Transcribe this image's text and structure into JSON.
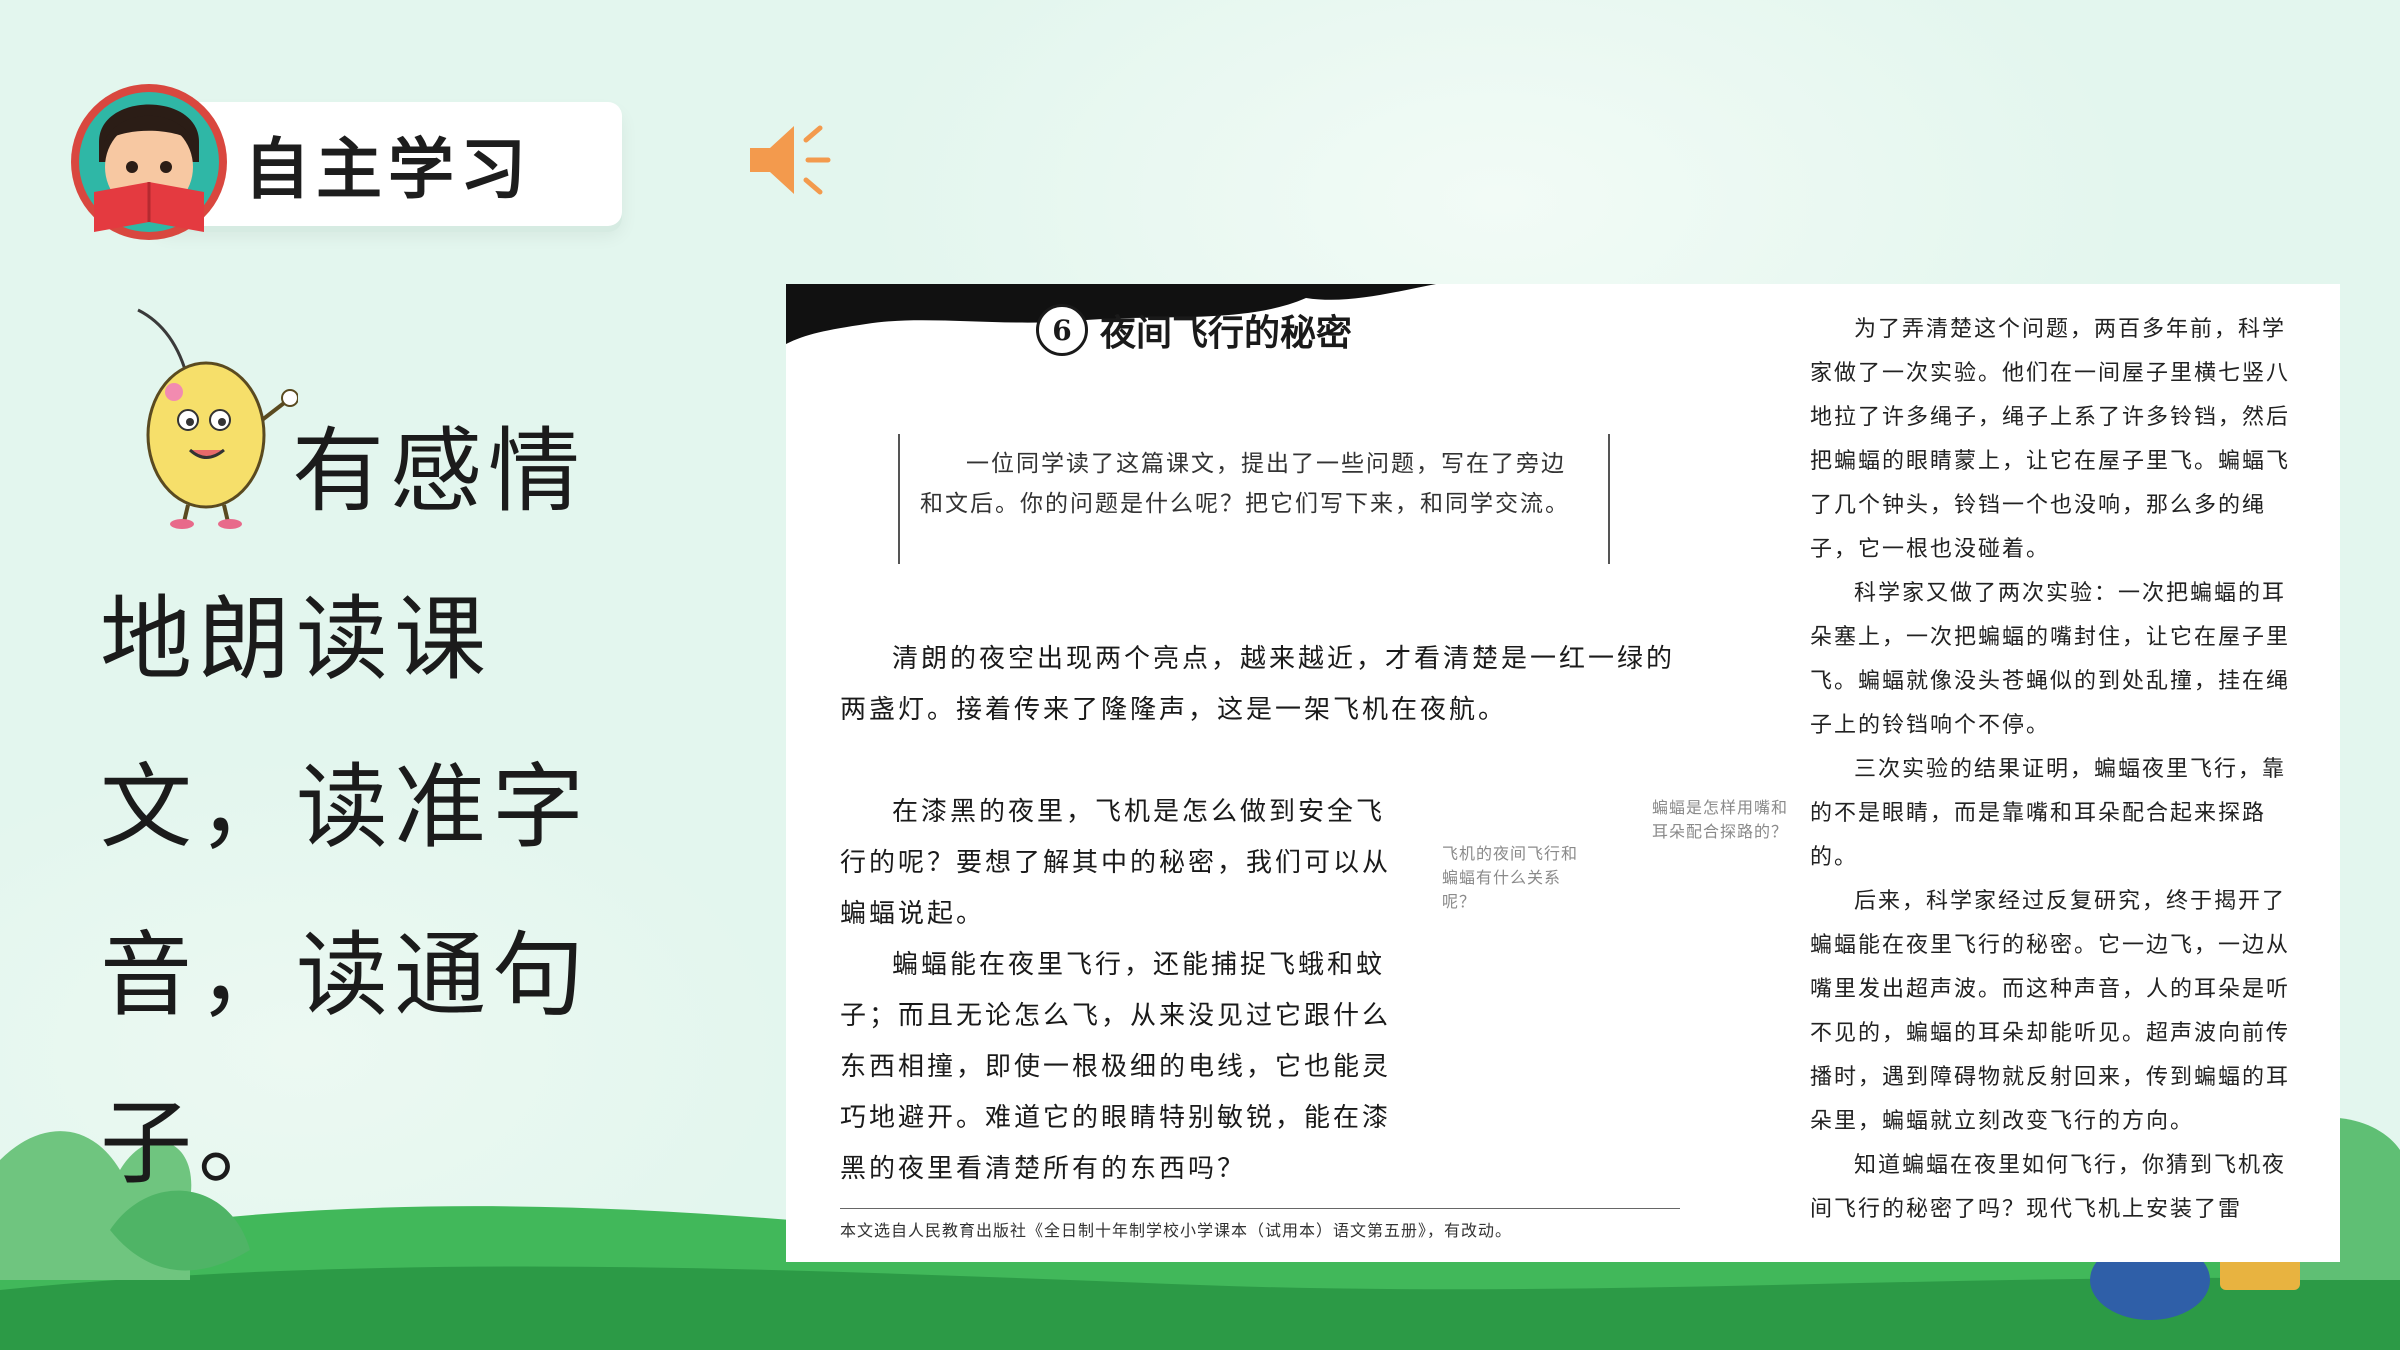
{
  "header": {
    "badge_label": "自主学习"
  },
  "prompt": {
    "text": "有感情地朗读课文，读准字音，读通句子。"
  },
  "textbook": {
    "lesson_number": "6",
    "lesson_title": "夜间飞行的秘密",
    "intro_note": "一位同学读了这篇课文，提出了一些问题，写在了旁边和文后。你的问题是什么呢？把它们写下来，和同学交流。",
    "left_paragraphs": [
      "清朗的夜空出现两个亮点，越来越近，才看清楚是一红一绿的两盏灯。接着传来了隆隆声，这是一架飞机在夜航。",
      "在漆黑的夜里，飞机是怎么做到安全飞行的呢？要想了解其中的秘密，我们可以从蝙蝠说起。",
      "蝙蝠能在夜里飞行，还能捕捉飞蛾和蚊子；而且无论怎么飞，从来没见过它跟什么东西相撞，即使一根极细的电线，它也能灵巧地避开。难道它的眼睛特别敏锐，能在漆黑的夜里看清楚所有的东西吗？"
    ],
    "side_note_1": "飞机的夜间飞行和蝙蝠有什么关系呢？",
    "side_note_2": "蝙蝠是怎样用嘴和耳朵配合探路的？",
    "right_paragraphs": [
      "为了弄清楚这个问题，两百多年前，科学家做了一次实验。他们在一间屋子里横七竖八地拉了许多绳子，绳子上系了许多铃铛，然后把蝙蝠的眼睛蒙上，让它在屋子里飞。蝙蝠飞了几个钟头，铃铛一个也没响，那么多的绳子，它一根也没碰着。",
      "科学家又做了两次实验：一次把蝙蝠的耳朵塞上，一次把蝙蝠的嘴封住，让它在屋子里飞。蝙蝠就像没头苍蝇似的到处乱撞，挂在绳子上的铃铛响个不停。",
      "三次实验的结果证明，蝙蝠夜里飞行，靠的不是眼睛，而是靠嘴和耳朵配合起来探路的。",
      "后来，科学家经过反复研究，终于揭开了蝙蝠能在夜里飞行的秘密。它一边飞，一边从嘴里发出超声波。而这种声音，人的耳朵是听不见的，蝙蝠的耳朵却能听见。超声波向前传播时，遇到障碍物就反射回来，传到蝙蝠的耳朵里，蝙蝠就立刻改变飞行的方向。",
      "知道蝙蝠在夜里如何飞行，你猜到飞机夜间飞行的秘密了吗？现代飞机上安装了雷"
    ],
    "footnote": "本文选自人民教育出版社《全日制十年制学校小学课本（试用本）语文第五册》，有改动。"
  },
  "icons": {
    "speaker": "speaker-icon",
    "avatar": "reading-boy-avatar",
    "mascot": "cartoon-egg-mascot"
  },
  "colors": {
    "background": "#e3f6ee",
    "speaker": "#f39a4d",
    "grass": "#2fa34a"
  }
}
